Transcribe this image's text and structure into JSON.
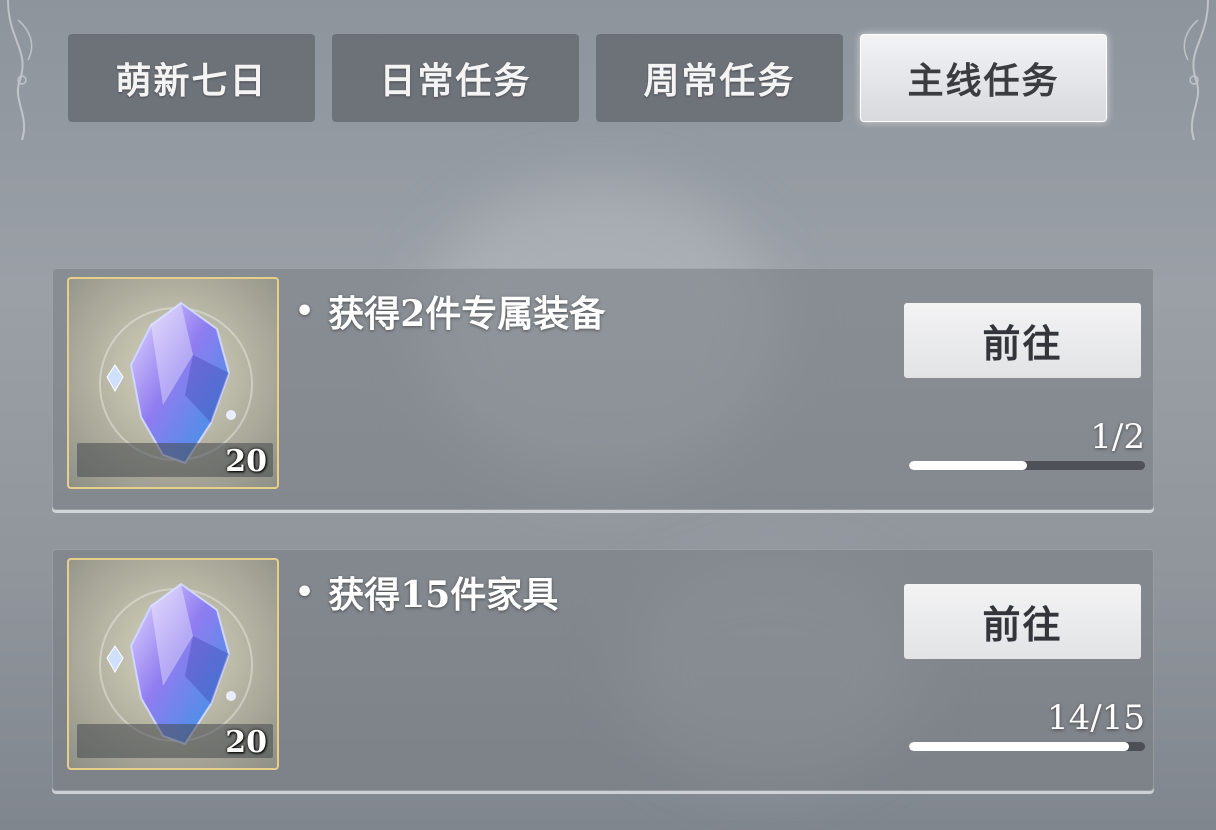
{
  "tabs": [
    {
      "label": "萌新七日",
      "active": false
    },
    {
      "label": "日常任务",
      "active": false
    },
    {
      "label": "周常任务",
      "active": false
    },
    {
      "label": "主线任务",
      "active": true
    }
  ],
  "tasks": [
    {
      "description": "获得2件专属装备",
      "reward_icon": "crystal-icon",
      "reward_count": "20",
      "button_label": "前往",
      "progress_text": "1/2",
      "progress_fraction": 0.5
    },
    {
      "description": "获得15件家具",
      "reward_icon": "crystal-icon",
      "reward_count": "20",
      "button_label": "前往",
      "progress_text": "14/15",
      "progress_fraction": 0.933
    }
  ],
  "colors": {
    "active_tab": "#e6e7ea",
    "inactive_tab": "#50545a",
    "reward_border": "#e6cf8a",
    "progress_fill": "#ffffff"
  },
  "bullet": "•"
}
